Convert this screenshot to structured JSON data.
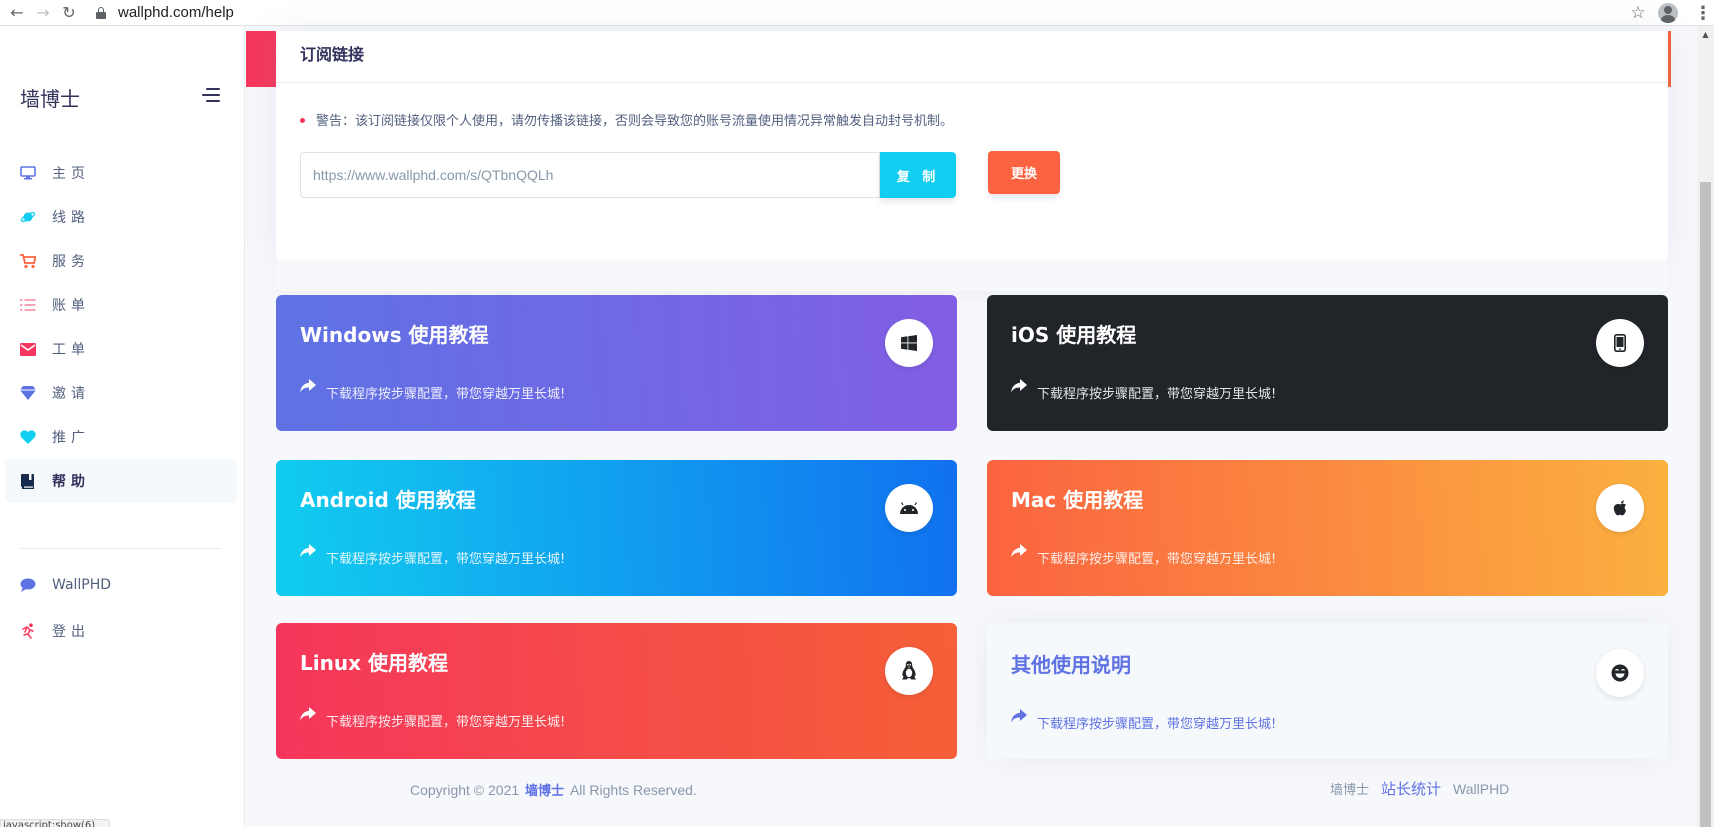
{
  "browser": {
    "url": "wallphd.com/help",
    "back_icon": "←",
    "forward_icon": "→",
    "reload_icon": "↻",
    "star_icon": "☆",
    "menu_icon": "⋮"
  },
  "sidebar": {
    "brand": "墙博士",
    "items": [
      {
        "label": "主页",
        "icon": "monitor-icon",
        "color": "#5e72e4"
      },
      {
        "label": "线路",
        "icon": "planet-icon",
        "color": "#11cdef"
      },
      {
        "label": "服务",
        "icon": "cart-icon",
        "color": "#fb6340"
      },
      {
        "label": "账单",
        "icon": "list-icon",
        "color": "#f3a4b5"
      },
      {
        "label": "工单",
        "icon": "email-icon",
        "color": "#f5365c"
      },
      {
        "label": "邀请",
        "icon": "diamond-icon",
        "color": "#5e72e4"
      },
      {
        "label": "推广",
        "icon": "heart-icon",
        "color": "#11cdef"
      },
      {
        "label": "帮助",
        "icon": "book-icon",
        "color": "#172b4d"
      }
    ],
    "extra_items": [
      {
        "label": "WallPHD",
        "icon": "chat-icon",
        "color": "#5e72e4"
      },
      {
        "label": "登出",
        "icon": "run-icon",
        "color": "#f5365c"
      }
    ],
    "active": "帮助"
  },
  "status_bar": "javascript:show(6)",
  "subscription": {
    "title": "订阅链接",
    "warning": "警告：该订阅链接仅限个人使用，请勿传播该链接，否则会导致您的账号流量使用情况异常触发自动封号机制。",
    "url": "https://www.wallphd.com/s/QTbnQQLh",
    "copy_label": "复 制",
    "reset_label": "更换"
  },
  "tutorials": [
    {
      "title": "Windows 使用教程",
      "desc": "下载程序按步骤配置，带您穿越万里长城!",
      "icon": "windows-icon"
    },
    {
      "title": "iOS 使用教程",
      "desc": "下载程序按步骤配置，带您穿越万里长城!",
      "icon": "mobile-icon"
    },
    {
      "title": "Android 使用教程",
      "desc": "下载程序按步骤配置，带您穿越万里长城!",
      "icon": "android-icon"
    },
    {
      "title": "Mac 使用教程",
      "desc": "下载程序按步骤配置，带您穿越万里长城!",
      "icon": "apple-icon"
    },
    {
      "title": "Linux 使用教程",
      "desc": "下载程序按步骤配置，带您穿越万里长城!",
      "icon": "linux-icon"
    },
    {
      "title": "其他使用说明",
      "desc": "下载程序按步骤配置，带您穿越万里长城!",
      "icon": "smile-icon"
    }
  ],
  "footer": {
    "copyright_prefix": "Copyright © 2021",
    "brand": "墙博士",
    "copyright_suffix": "All Rights Reserved.",
    "links": [
      "墙博士",
      "站长统计",
      "WallPHD"
    ]
  }
}
